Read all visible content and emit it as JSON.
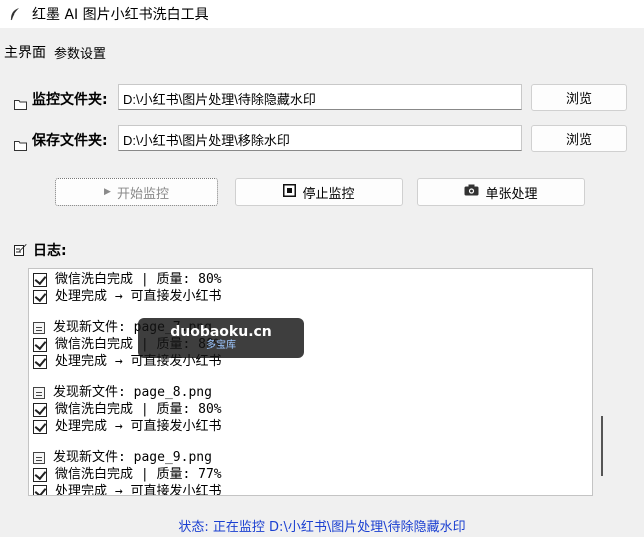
{
  "window": {
    "title": "红墨 AI 图片小红书洗白工具",
    "icon": "feather-icon"
  },
  "tabs": [
    {
      "label": "主界面",
      "active": true
    },
    {
      "label": "参数设置",
      "active": false
    }
  ],
  "monitor_folder": {
    "label": "监控文件夹:",
    "value": "D:\\小红书\\图片处理\\待除隐藏水印",
    "browse_label": "浏览"
  },
  "save_folder": {
    "label": "保存文件夹:",
    "value": "D:\\小红书\\图片处理\\移除水印",
    "browse_label": "浏览"
  },
  "actions": {
    "start_label": "开始监控",
    "start_icon": "play-icon",
    "stop_label": "停止监控",
    "stop_icon": "stop-icon",
    "single_label": "单张处理",
    "single_icon": "camera-icon"
  },
  "log": {
    "label": "日志:",
    "lines": [
      {
        "type": "check",
        "text": "微信洗白完成 | 质量: 80%"
      },
      {
        "type": "check",
        "text": "处理完成 → 可直接发小红书"
      },
      {
        "type": "blank",
        "text": ""
      },
      {
        "type": "file",
        "text": "发现新文件: page_7.png"
      },
      {
        "type": "check",
        "text": "微信洗白完成 | 质量: 80%"
      },
      {
        "type": "check",
        "text": "处理完成 → 可直接发小红书"
      },
      {
        "type": "blank",
        "text": ""
      },
      {
        "type": "file",
        "text": "发现新文件: page_8.png"
      },
      {
        "type": "check",
        "text": "微信洗白完成 | 质量: 80%"
      },
      {
        "type": "check",
        "text": "处理完成 → 可直接发小红书"
      },
      {
        "type": "blank",
        "text": ""
      },
      {
        "type": "file",
        "text": "发现新文件: page_9.png"
      },
      {
        "type": "check",
        "text": "微信洗白完成 | 质量: 77%"
      },
      {
        "type": "check",
        "text": "处理完成 → 可直接发小红书"
      }
    ]
  },
  "status": {
    "text": "状态: 正在监控 D:\\小红书\\图片处理\\待除隐藏水印"
  },
  "watermark": {
    "domain": "duobaoku.cn",
    "name": "多宝库"
  },
  "colors": {
    "status_text": "#1a3fd1",
    "background": "#f0f0f0"
  }
}
